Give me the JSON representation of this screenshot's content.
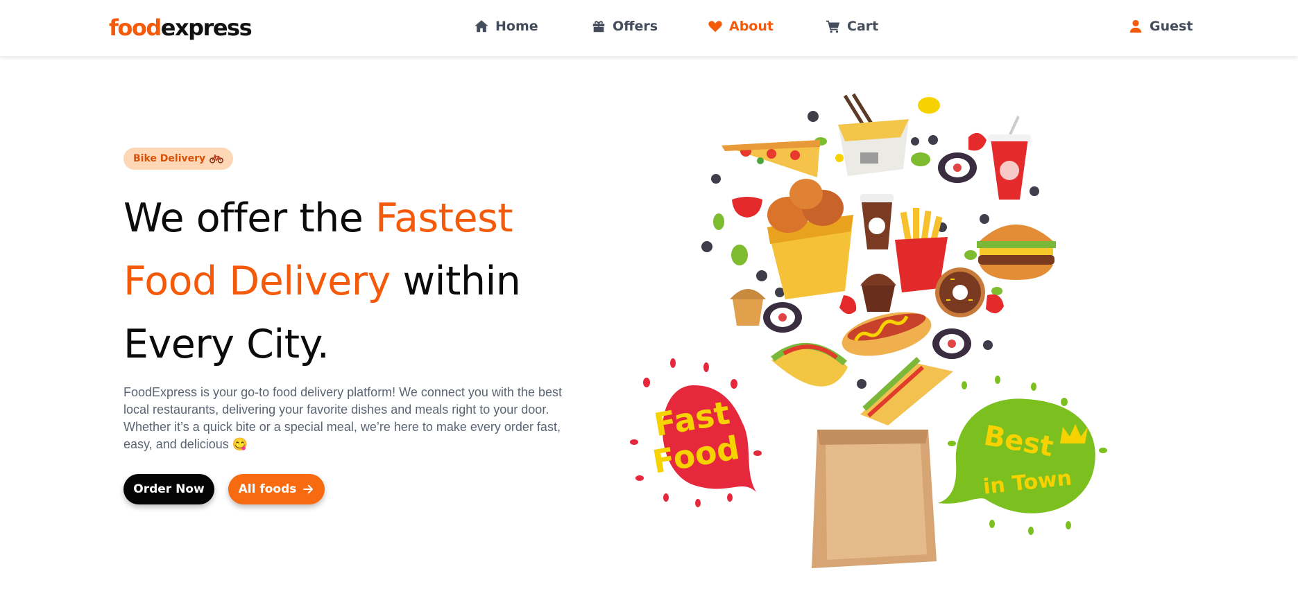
{
  "brand": {
    "part1": "food",
    "part2": "express",
    "accent_color": "#f55a0b"
  },
  "nav": {
    "home": "Home",
    "offers": "Offers",
    "about": "About",
    "cart": "Cart",
    "guest": "Guest",
    "active": "About"
  },
  "hero": {
    "badge": "Bike Delivery",
    "title_1": "We offer the ",
    "title_2": "Fastest",
    "title_3": "Food Delivery",
    "title_4": " within",
    "title_5": "Every City.",
    "description": "FoodExpress is your go-to food delivery platform! We connect you with the best local restaurants, delivering your favorite dishes and meals right to your door. Whether it’s a quick bite or a special meal, we’re here to make every order fast, easy, and delicious 😋",
    "btn_order": "Order Now",
    "btn_all": "All foods"
  },
  "illustration": {
    "bubble_left": [
      "Fast",
      "Food"
    ],
    "bubble_right": [
      "Best",
      "in Town"
    ]
  }
}
